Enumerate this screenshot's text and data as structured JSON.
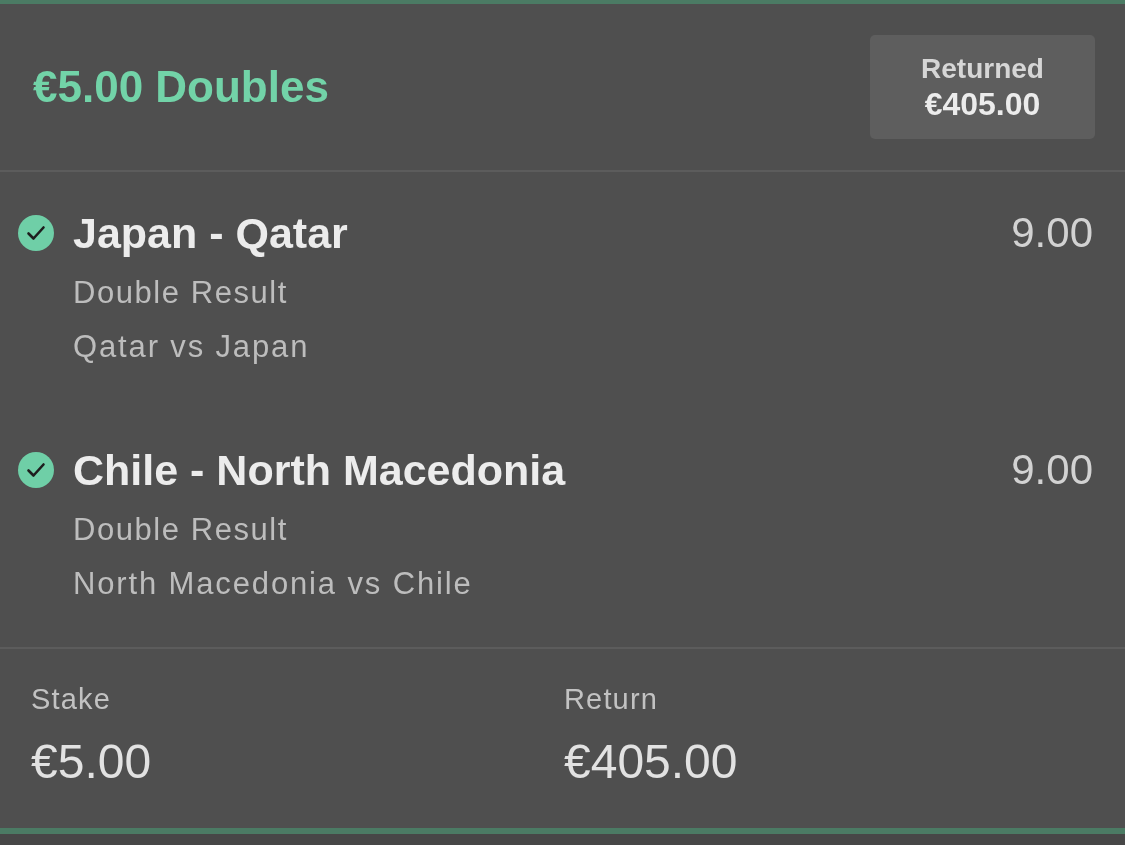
{
  "bet": {
    "title": "€5.00 Doubles",
    "status_badge": {
      "label": "Returned",
      "amount": "€405.00"
    }
  },
  "selections": [
    {
      "name": "Japan - Qatar",
      "odds": "9.00",
      "market": "Double Result",
      "event": "Qatar vs Japan",
      "won": true
    },
    {
      "name": "Chile - North Macedonia",
      "odds": "9.00",
      "market": "Double Result",
      "event": "North Macedonia vs Chile",
      "won": true
    }
  ],
  "summary": [
    {
      "label": "Stake",
      "value": "€5.00"
    },
    {
      "label": "Return",
      "value": "€405.00"
    }
  ]
}
